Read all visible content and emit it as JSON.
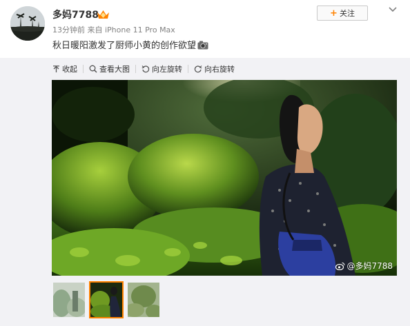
{
  "post": {
    "username": "多妈7788",
    "time": "13分钟前",
    "source": "来自 iPhone 11 Pro Max",
    "text": "秋日暖阳激发了厨师小黄的创作欲望",
    "follow_label": "关注"
  },
  "toolbar": {
    "collapse": "收起",
    "view_large": "查看大图",
    "rotate_left": "向左旋转",
    "rotate_right": "向右旋转"
  },
  "image": {
    "watermark": "@多妈7788"
  },
  "thumbnails": {
    "count": 3,
    "active_index": 1
  },
  "colors": {
    "accent": "#ff8200",
    "media_bg": "#f2f2f5"
  }
}
